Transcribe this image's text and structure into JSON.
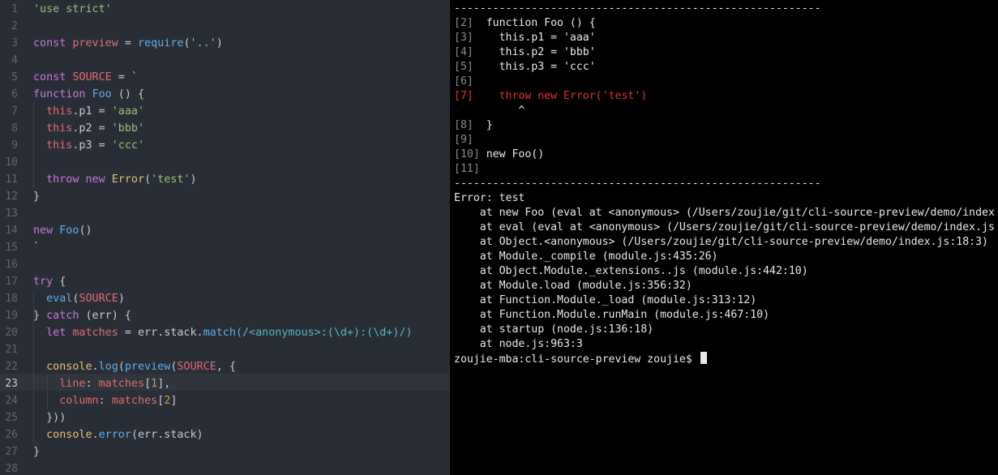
{
  "editor": {
    "current_line": 23,
    "lines": [
      [
        [
          "'use strict'",
          "str"
        ]
      ],
      [],
      [
        [
          "const ",
          "kw"
        ],
        [
          "preview",
          "var"
        ],
        [
          " = ",
          "pl"
        ],
        [
          "require",
          "fn"
        ],
        [
          "(",
          "pl"
        ],
        [
          "'..'",
          "str"
        ],
        [
          ")",
          "pl"
        ]
      ],
      [],
      [
        [
          "const ",
          "kw"
        ],
        [
          "SOURCE",
          "var"
        ],
        [
          " = `",
          "pl"
        ]
      ],
      [
        [
          "function ",
          "kw"
        ],
        [
          "Foo",
          "fn"
        ],
        [
          " () {",
          "pl"
        ]
      ],
      [
        [
          "  ",
          "pl"
        ],
        [
          "this",
          "var"
        ],
        [
          ".p1 = ",
          "pl"
        ],
        [
          "'aaa'",
          "str"
        ]
      ],
      [
        [
          "  ",
          "pl"
        ],
        [
          "this",
          "var"
        ],
        [
          ".p2 = ",
          "pl"
        ],
        [
          "'bbb'",
          "str"
        ]
      ],
      [
        [
          "  ",
          "pl"
        ],
        [
          "this",
          "var"
        ],
        [
          ".p3 = ",
          "pl"
        ],
        [
          "'ccc'",
          "str"
        ]
      ],
      [],
      [
        [
          "  ",
          "pl"
        ],
        [
          "throw ",
          "kw"
        ],
        [
          "new ",
          "kw"
        ],
        [
          "Error",
          "cls"
        ],
        [
          "(",
          "pl"
        ],
        [
          "'test'",
          "str"
        ],
        [
          ")",
          "pl"
        ]
      ],
      [
        [
          "}",
          "pl"
        ]
      ],
      [],
      [
        [
          "new ",
          "kw"
        ],
        [
          "Foo",
          "fn"
        ],
        [
          "()",
          "pl"
        ]
      ],
      [
        [
          "`",
          "pl"
        ]
      ],
      [],
      [
        [
          "try ",
          "kw"
        ],
        [
          "{",
          "pl"
        ]
      ],
      [
        [
          "  ",
          "pl"
        ],
        [
          "eval",
          "fn"
        ],
        [
          "(",
          "pl"
        ],
        [
          "SOURCE",
          "var"
        ],
        [
          ")",
          "pl"
        ]
      ],
      [
        [
          "} ",
          "pl"
        ],
        [
          "catch ",
          "kw"
        ],
        [
          "(err) {",
          "pl"
        ]
      ],
      [
        [
          "  ",
          "pl"
        ],
        [
          "let ",
          "kw"
        ],
        [
          "matches",
          "var"
        ],
        [
          " = err.stack.",
          "pl"
        ],
        [
          "match",
          "fn"
        ],
        [
          "(/<anonymous>:(\\d+):(\\d+)/)",
          "rx"
        ]
      ],
      [],
      [
        [
          "  ",
          "pl"
        ],
        [
          "console",
          "cls"
        ],
        [
          ".",
          "pl"
        ],
        [
          "log",
          "fn"
        ],
        [
          "(",
          "pl"
        ],
        [
          "preview",
          "fn"
        ],
        [
          "(",
          "pl"
        ],
        [
          "SOURCE",
          "var"
        ],
        [
          ", {",
          "pl"
        ]
      ],
      [
        [
          "    ",
          "pl"
        ],
        [
          "line",
          "prop"
        ],
        [
          ": ",
          "pl"
        ],
        [
          "matches",
          "var"
        ],
        [
          "[",
          "pl"
        ],
        [
          "1",
          "num"
        ],
        [
          "],",
          "pl"
        ]
      ],
      [
        [
          "    ",
          "pl"
        ],
        [
          "column",
          "prop"
        ],
        [
          ": ",
          "pl"
        ],
        [
          "matches",
          "var"
        ],
        [
          "[",
          "pl"
        ],
        [
          "2",
          "num"
        ],
        [
          "]",
          "pl"
        ]
      ],
      [
        [
          "  }))",
          "pl"
        ]
      ],
      [
        [
          "  ",
          "pl"
        ],
        [
          "console",
          "cls"
        ],
        [
          ".",
          "pl"
        ],
        [
          "error",
          "fn"
        ],
        [
          "(err.stack)",
          "pl"
        ]
      ],
      [
        [
          "}",
          "pl"
        ]
      ],
      []
    ]
  },
  "terminal": {
    "lines": [
      {
        "text": "---------------------------------------------------------"
      },
      {
        "num": "[2]",
        "pad": "  ",
        "text": "function Foo () {"
      },
      {
        "num": "[3]",
        "pad": "    ",
        "text": "this.p1 = 'aaa'"
      },
      {
        "num": "[4]",
        "pad": "    ",
        "text": "this.p2 = 'bbb'"
      },
      {
        "num": "[5]",
        "pad": "    ",
        "text": "this.p3 = 'ccc'"
      },
      {
        "num": "[6]",
        "pad": "",
        "text": ""
      },
      {
        "num": "[7]",
        "pad": "    ",
        "text": "throw new Error('test')",
        "error": true
      },
      {
        "text": "          ^"
      },
      {
        "num": "[8]",
        "pad": "  ",
        "text": "}"
      },
      {
        "num": "[9]",
        "pad": "",
        "text": ""
      },
      {
        "num": "[10]",
        "pad": " ",
        "text": "new Foo()"
      },
      {
        "num": "[11]",
        "pad": "",
        "text": ""
      },
      {
        "text": "---------------------------------------------------------"
      },
      {
        "text": "Error: test"
      },
      {
        "text": "    at new Foo (eval at <anonymous> (/Users/zoujie/git/cli-source-preview/demo/index"
      },
      {
        "text": "    at eval (eval at <anonymous> (/Users/zoujie/git/cli-source-preview/demo/index.js"
      },
      {
        "text": "    at Object.<anonymous> (/Users/zoujie/git/cli-source-preview/demo/index.js:18:3)"
      },
      {
        "text": "    at Module._compile (module.js:435:26)"
      },
      {
        "text": "    at Object.Module._extensions..js (module.js:442:10)"
      },
      {
        "text": "    at Module.load (module.js:356:32)"
      },
      {
        "text": "    at Function.Module._load (module.js:313:12)"
      },
      {
        "text": "    at Function.Module.runMain (module.js:467:10)"
      },
      {
        "text": "    at startup (node.js:136:18)"
      },
      {
        "text": "    at node.js:963:3"
      },
      {
        "text": "zoujie-mba:cli-source-preview zoujie$ ",
        "prompt": true
      }
    ]
  },
  "colors": {
    "editor_bg": "#292d35",
    "string": "#98c379",
    "keyword": "#c678dd",
    "variable": "#e06c75",
    "function": "#61afef",
    "class": "#e5c07b",
    "number": "#d19a66",
    "regex": "#56b6c2",
    "terminal_bg": "#000000",
    "terminal_error": "#e5302d"
  }
}
